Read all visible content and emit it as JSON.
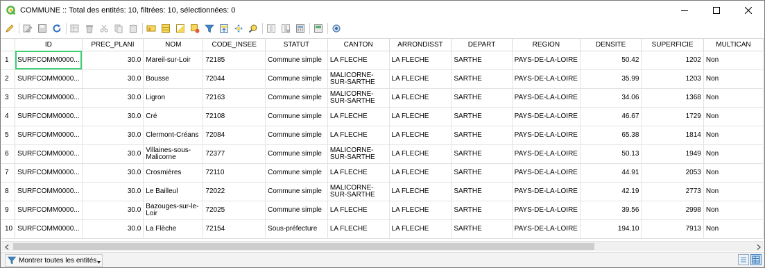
{
  "window": {
    "title": "COMMUNE :: Total des entités: 10, filtrées: 10, sélectionnées: 0",
    "minimize_icon": "minimize-icon",
    "maximize_icon": "maximize-icon",
    "close_icon": "close-icon"
  },
  "toolbar": {
    "icons": [
      "edit-pencil-icon",
      "multi-edit-icon",
      "save-edits-icon",
      "reload-icon",
      "add-feature-icon",
      "delete-feature-icon",
      "cut-icon",
      "copy-icon",
      "paste-icon",
      "select-by-expression-icon",
      "select-all-icon",
      "invert-selection-icon",
      "deselect-all-icon",
      "filter-select-icon",
      "move-selection-top-icon",
      "pan-to-selection-icon",
      "zoom-to-selection-icon",
      "new-field-icon",
      "delete-field-icon",
      "field-calculator-icon",
      "conditional-formatting-icon",
      "actions-icon"
    ]
  },
  "table": {
    "columns": [
      "ID",
      "PREC_PLANI",
      "NOM",
      "CODE_INSEE",
      "STATUT",
      "CANTON",
      "ARRONDISST",
      "DEPART",
      "REGION",
      "DENSITE",
      "SUPERFICIE",
      "MULTICAN"
    ],
    "rows": [
      {
        "n": "1",
        "id": "SURFCOMM0000...",
        "prec": "30.0",
        "nom": "Mareil-sur-Loir",
        "code": "72185",
        "statut": "Commune simple",
        "canton": "LA FLECHE",
        "arr": "LA FLECHE",
        "dep": "SARTHE",
        "reg": "PAYS-DE-LA-LOIRE",
        "dens": "50.42",
        "sup": "1202",
        "multi": "Non"
      },
      {
        "n": "2",
        "id": "SURFCOMM0000...",
        "prec": "30.0",
        "nom": "Bousse",
        "code": "72044",
        "statut": "Commune simple",
        "canton": "MALICORNE-SUR-SARTHE",
        "arr": "LA FLECHE",
        "dep": "SARTHE",
        "reg": "PAYS-DE-LA-LOIRE",
        "dens": "35.99",
        "sup": "1203",
        "multi": "Non"
      },
      {
        "n": "3",
        "id": "SURFCOMM0000...",
        "prec": "30.0",
        "nom": "Ligron",
        "code": "72163",
        "statut": "Commune simple",
        "canton": "MALICORNE-SUR-SARTHE",
        "arr": "LA FLECHE",
        "dep": "SARTHE",
        "reg": "PAYS-DE-LA-LOIRE",
        "dens": "34.06",
        "sup": "1368",
        "multi": "Non"
      },
      {
        "n": "4",
        "id": "SURFCOMM0000...",
        "prec": "30.0",
        "nom": "Cré",
        "code": "72108",
        "statut": "Commune simple",
        "canton": "LA FLECHE",
        "arr": "LA FLECHE",
        "dep": "SARTHE",
        "reg": "PAYS-DE-LA-LOIRE",
        "dens": "46.67",
        "sup": "1729",
        "multi": "Non"
      },
      {
        "n": "5",
        "id": "SURFCOMM0000...",
        "prec": "30.0",
        "nom": "Clermont-Créans",
        "code": "72084",
        "statut": "Commune simple",
        "canton": "LA FLECHE",
        "arr": "LA FLECHE",
        "dep": "SARTHE",
        "reg": "PAYS-DE-LA-LOIRE",
        "dens": "65.38",
        "sup": "1814",
        "multi": "Non"
      },
      {
        "n": "6",
        "id": "SURFCOMM0000...",
        "prec": "30.0",
        "nom": "Villaines-sous-Malicorne",
        "code": "72377",
        "statut": "Commune simple",
        "canton": "MALICORNE-SUR-SARTHE",
        "arr": "LA FLECHE",
        "dep": "SARTHE",
        "reg": "PAYS-DE-LA-LOIRE",
        "dens": "50.13",
        "sup": "1949",
        "multi": "Non"
      },
      {
        "n": "7",
        "id": "SURFCOMM0000...",
        "prec": "30.0",
        "nom": "Crosmières",
        "code": "72110",
        "statut": "Commune simple",
        "canton": "LA FLECHE",
        "arr": "LA FLECHE",
        "dep": "SARTHE",
        "reg": "PAYS-DE-LA-LOIRE",
        "dens": "44.91",
        "sup": "2053",
        "multi": "Non"
      },
      {
        "n": "8",
        "id": "SURFCOMM0000...",
        "prec": "30.0",
        "nom": "Le Bailleul",
        "code": "72022",
        "statut": "Commune simple",
        "canton": "MALICORNE-SUR-SARTHE",
        "arr": "LA FLECHE",
        "dep": "SARTHE",
        "reg": "PAYS-DE-LA-LOIRE",
        "dens": "42.19",
        "sup": "2773",
        "multi": "Non"
      },
      {
        "n": "9",
        "id": "SURFCOMM0000...",
        "prec": "30.0",
        "nom": "Bazouges-sur-le-Loir",
        "code": "72025",
        "statut": "Commune simple",
        "canton": "LA FLECHE",
        "arr": "LA FLECHE",
        "dep": "SARTHE",
        "reg": "PAYS-DE-LA-LOIRE",
        "dens": "39.56",
        "sup": "2998",
        "multi": "Non"
      },
      {
        "n": "10",
        "id": "SURFCOMM0000...",
        "prec": "30.0",
        "nom": "La Flèche",
        "code": "72154",
        "statut": "Sous-préfecture",
        "canton": "LA FLECHE",
        "arr": "LA FLECHE",
        "dep": "SARTHE",
        "reg": "PAYS-DE-LA-LOIRE",
        "dens": "194.10",
        "sup": "7913",
        "multi": "Non"
      }
    ]
  },
  "bottom": {
    "show_all_label": "Montrer toutes les entités",
    "filter_icon": "filter-icon",
    "table_view_icon": "table-view-icon",
    "form_view_icon": "form-view-icon"
  },
  "colors": {
    "selection_outline": "#3ecf77",
    "qgis_green": "#58b548"
  }
}
